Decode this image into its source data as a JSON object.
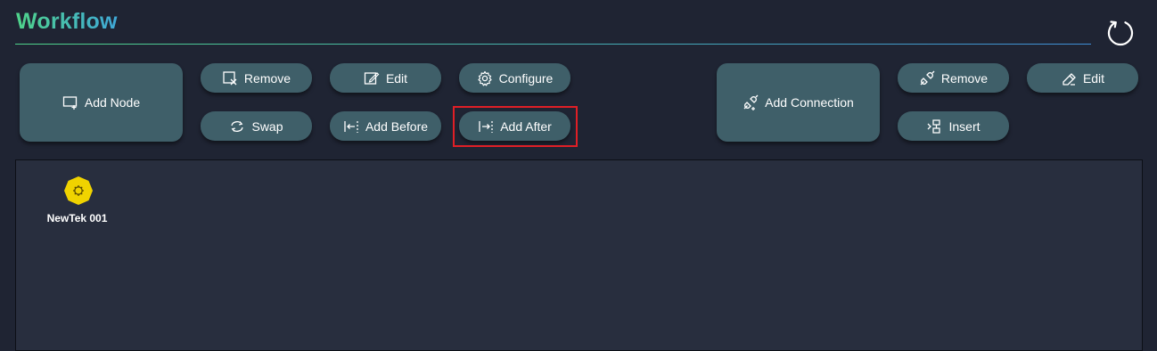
{
  "header": {
    "title": "Workflow"
  },
  "toolbar": {
    "node_actions": {
      "add_node": "Add Node",
      "remove": "Remove",
      "edit": "Edit",
      "configure": "Configure",
      "swap": "Swap",
      "add_before": "Add Before",
      "add_after": "Add After"
    },
    "connection_actions": {
      "add_connection": "Add Connection",
      "remove": "Remove",
      "edit": "Edit",
      "insert": "Insert"
    }
  },
  "canvas": {
    "nodes": [
      {
        "label": "NewTek 001",
        "icon": "newtek-gear-icon",
        "color": "#f0d300"
      }
    ]
  },
  "colors": {
    "background": "#1f2433",
    "canvas": "#282e3e",
    "button": "#3f5f69",
    "highlight": "#e01f26",
    "title_gradient_start": "#4fd38a",
    "title_gradient_end": "#3fa8d8",
    "node": "#f0d300"
  }
}
